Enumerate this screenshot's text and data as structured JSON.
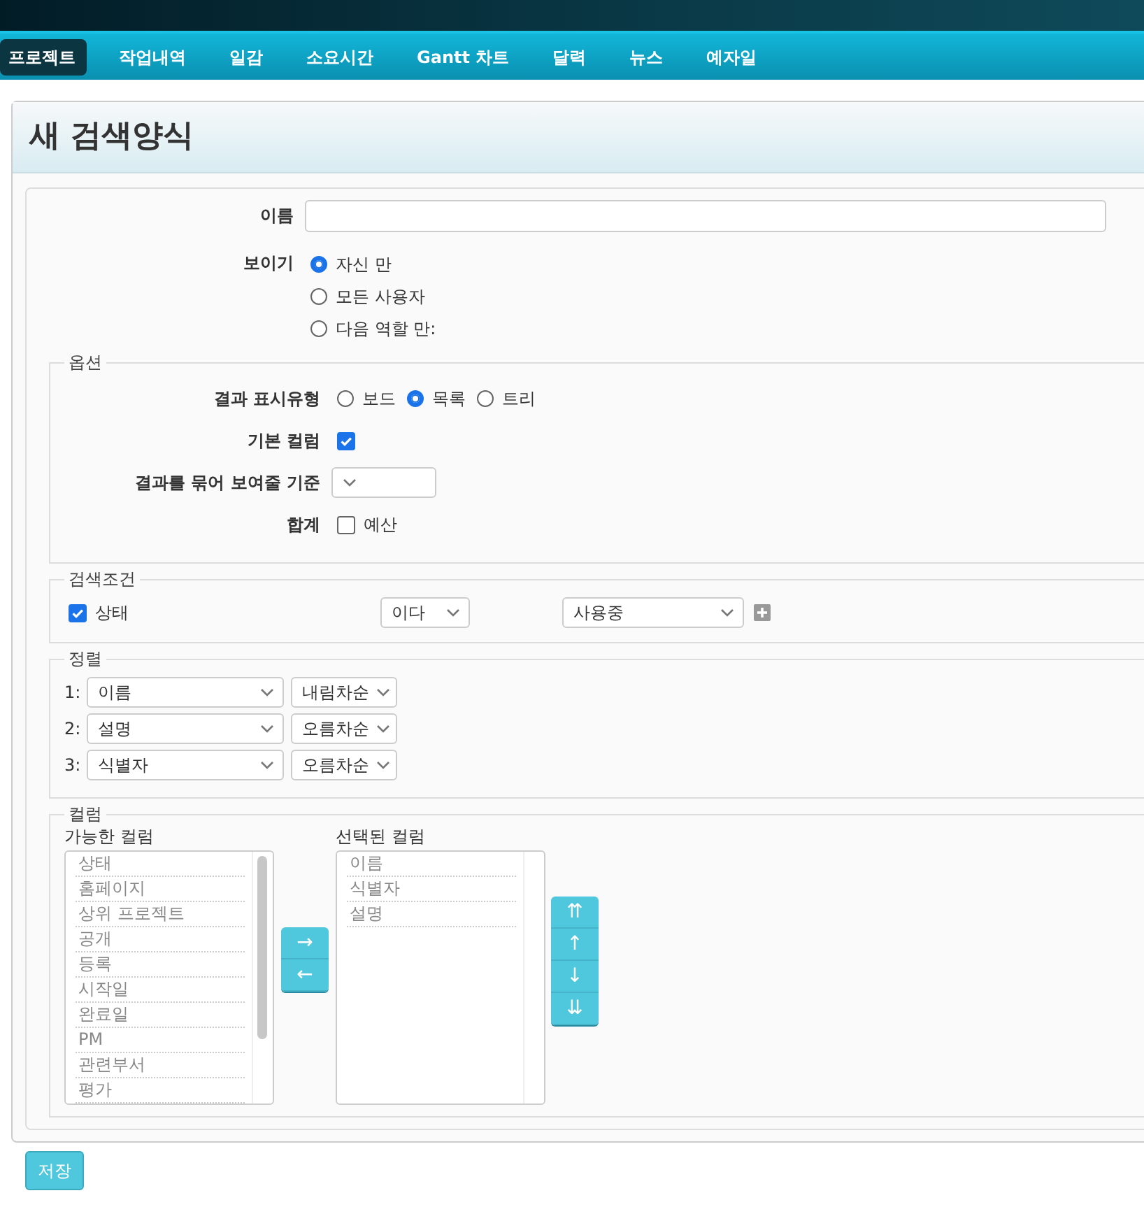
{
  "nav": {
    "items": [
      {
        "label": "프로젝트",
        "selected": true
      },
      {
        "label": "작업내역",
        "selected": false
      },
      {
        "label": "일감",
        "selected": false
      },
      {
        "label": "소요시간",
        "selected": false
      },
      {
        "label": "Gantt 차트",
        "selected": false
      },
      {
        "label": "달력",
        "selected": false
      },
      {
        "label": "뉴스",
        "selected": false
      },
      {
        "label": "예자일",
        "selected": false
      }
    ]
  },
  "page": {
    "title": "새 검색양식"
  },
  "form": {
    "name": {
      "label": "이름"
    },
    "visibility": {
      "label": "보이기",
      "options": [
        {
          "label": "자신 만",
          "selected": true
        },
        {
          "label": "모든 사용자",
          "selected": false
        },
        {
          "label": "다음 역할 만:",
          "selected": false
        }
      ]
    },
    "options": {
      "legend": "옵션",
      "display_type": {
        "label": "결과 표시유형",
        "options": [
          {
            "label": "보드",
            "selected": false
          },
          {
            "label": "목록",
            "selected": true
          },
          {
            "label": "트리",
            "selected": false
          }
        ]
      },
      "default_columns": {
        "label": "기본 컬럼",
        "checked": true
      },
      "group_by": {
        "label": "결과를 묶어 보여줄 기준"
      },
      "totals": {
        "label": "합계",
        "items": [
          {
            "label": "예산",
            "checked": false
          }
        ]
      }
    },
    "filters": {
      "legend": "검색조건",
      "rows": [
        {
          "label": "상태",
          "checked": true,
          "operator": "이다",
          "value": "사용중"
        }
      ]
    },
    "sort": {
      "legend": "정렬",
      "rows": [
        {
          "index": "1:",
          "field": "이름",
          "order": "내림차순"
        },
        {
          "index": "2:",
          "field": "설명",
          "order": "오름차순"
        },
        {
          "index": "3:",
          "field": "식별자",
          "order": "오름차순"
        }
      ]
    },
    "columns": {
      "legend": "컬럼",
      "available": {
        "label": "가능한 컬럼",
        "items": [
          "상태",
          "홈페이지",
          "상위 프로젝트",
          "공개",
          "등록",
          "시작일",
          "완료일",
          "PM",
          "관련부서",
          "평가"
        ]
      },
      "selected": {
        "label": "선택된 컬럼",
        "items": [
          "이름",
          "식별자",
          "설명"
        ]
      },
      "move_buttons": [
        "→",
        "←"
      ],
      "order_buttons": [
        "⇈",
        "↑",
        "↓",
        "⇊"
      ]
    }
  },
  "save": "저장"
}
